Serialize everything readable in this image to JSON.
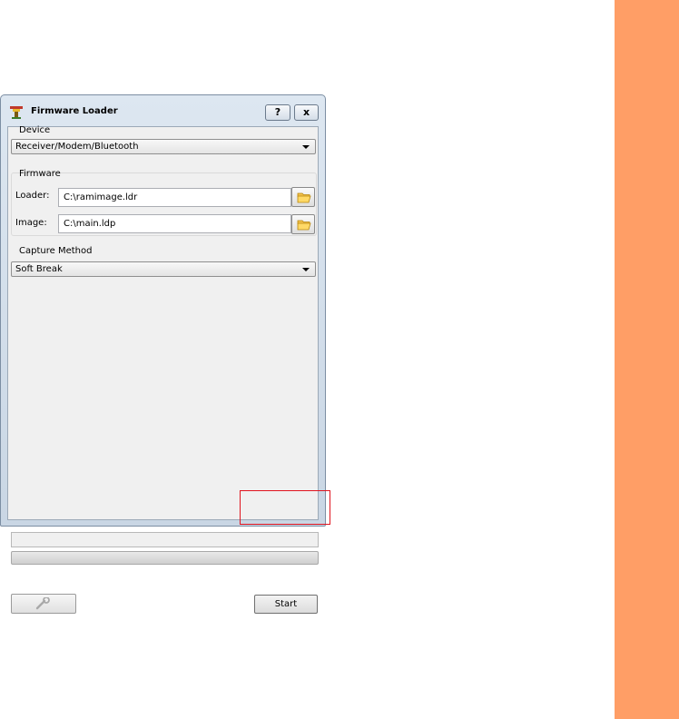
{
  "window": {
    "title": "Firmware Loader",
    "help_label": "?",
    "close_label": "x"
  },
  "device": {
    "group_label": "Device",
    "selected": "Receiver/Modem/Bluetooth"
  },
  "firmware": {
    "group_label": "Firmware",
    "loader_label": "Loader:",
    "loader_value": "C:\\ramimage.ldr",
    "image_label": "Image:",
    "image_value": "C:\\main.ldp"
  },
  "capture": {
    "group_label": "Capture Method",
    "selected": "Soft Break"
  },
  "progress": {
    "status_text": "",
    "fraction": 0
  },
  "buttons": {
    "start_label": "Start"
  },
  "icons": {
    "app": "firmware-loader-icon",
    "browse": "folder-open-icon",
    "settings": "wrench-icon"
  },
  "colors": {
    "highlight": "#e0141e",
    "accent_strip": "#ff9e66"
  }
}
